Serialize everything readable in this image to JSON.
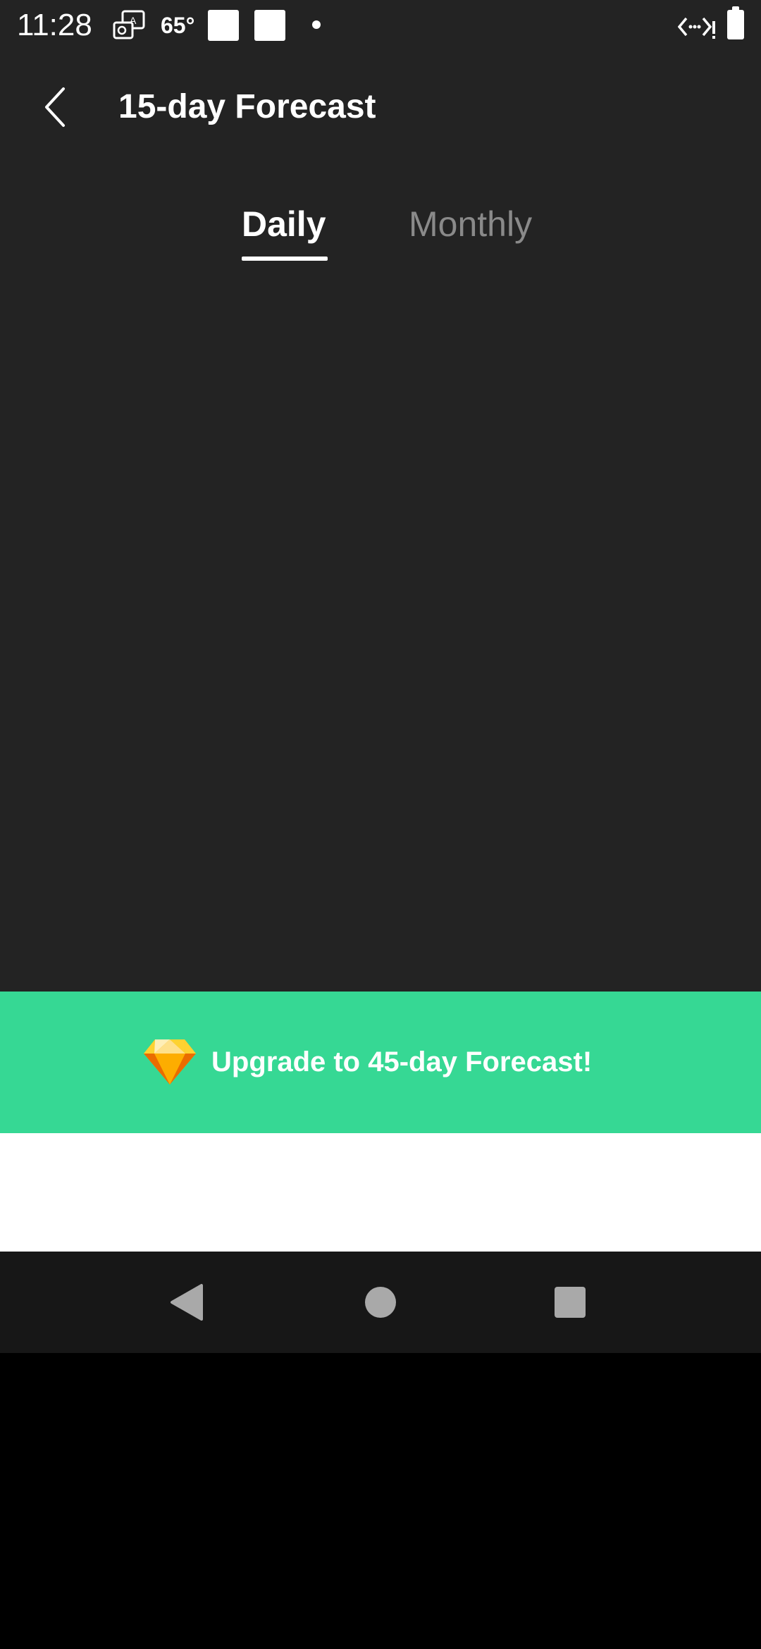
{
  "status_bar": {
    "time": "11:28",
    "temperature": "65°",
    "icons": [
      "translate-icon",
      "notification-square-icon",
      "notification-square-icon",
      "dot-icon",
      "data-saver-icon",
      "battery-icon"
    ]
  },
  "header": {
    "back_icon": "chevron-left-icon",
    "title": "15-day Forecast"
  },
  "tabs": [
    {
      "label": "Daily",
      "selected": true
    },
    {
      "label": "Monthly",
      "selected": false
    }
  ],
  "upgrade_banner": {
    "icon": "gem-icon",
    "label": "Upgrade to 45-day Forecast!",
    "background_color": "#36d894"
  },
  "nav_bar": {
    "icons": [
      "back-triangle-icon",
      "home-circle-icon",
      "recents-square-icon"
    ]
  },
  "colors": {
    "background": "#232323",
    "accent": "#36d894",
    "tab_inactive": "#8a8a8a"
  }
}
